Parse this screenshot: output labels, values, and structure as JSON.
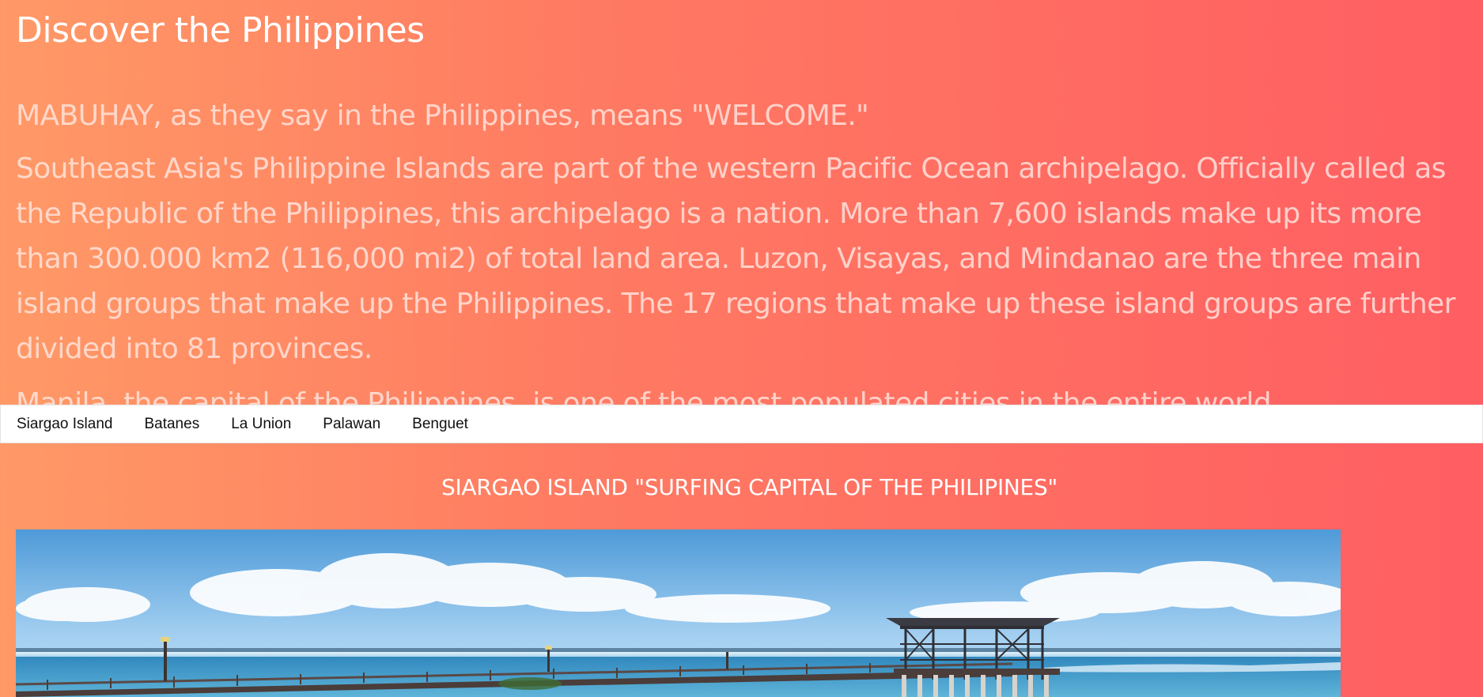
{
  "header": {
    "title": "Discover the Philippines"
  },
  "intro": {
    "welcome": "MABUHAY, as they say in the Philippines, means \"WELCOME.\"",
    "description": "Southeast Asia's Philippine Islands are part of the western Pacific Ocean archipelago. Officially called as the Republic of the Philippines, this archipelago is a nation. More than 7,600 islands make up its more than 300.000 km2 (116,000 mi2) of total land area. Luzon, Visayas, and Mindanao are the three main island groups that make up the Philippines. The 17 regions that make up these island groups are further divided into 81 provinces.",
    "capital": "Manila, the capital of the Philippines, is one of the most populated cities in the entire world."
  },
  "nav": {
    "items": [
      {
        "label": "Siargao Island"
      },
      {
        "label": "Batanes"
      },
      {
        "label": "La Union"
      },
      {
        "label": "Palawan"
      },
      {
        "label": "Benguet"
      }
    ]
  },
  "section": {
    "heading": "SIARGAO ISLAND \"SURFING CAPITAL OF THE PHILIPINES\""
  },
  "colors": {
    "gradient_start": "#ff9966",
    "gradient_end": "#ff5e62",
    "nav_background": "#ffffff"
  }
}
